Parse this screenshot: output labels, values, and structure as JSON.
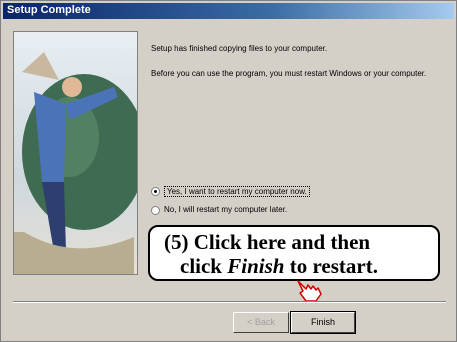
{
  "window": {
    "title": "Setup Complete"
  },
  "main": {
    "message1": "Setup has finished copying files to your computer.",
    "message2": "Before you can use the program, you must restart Windows or your computer.",
    "option_yes": "Yes, I want to restart my computer now.",
    "option_no": "No, I will restart my computer later.",
    "selected_option": "yes"
  },
  "callout": {
    "line1": "(5) Click here and then",
    "line2_pre": "click ",
    "line2_em": "Finish",
    "line2_post": " to restart."
  },
  "buttons": {
    "back_label": "< Back",
    "finish_label": "Finish"
  },
  "icons": {
    "pointer": "hand-pointer-icon"
  },
  "colors": {
    "titlebar": "#0a246a",
    "dialog": "#d4d0c8"
  }
}
